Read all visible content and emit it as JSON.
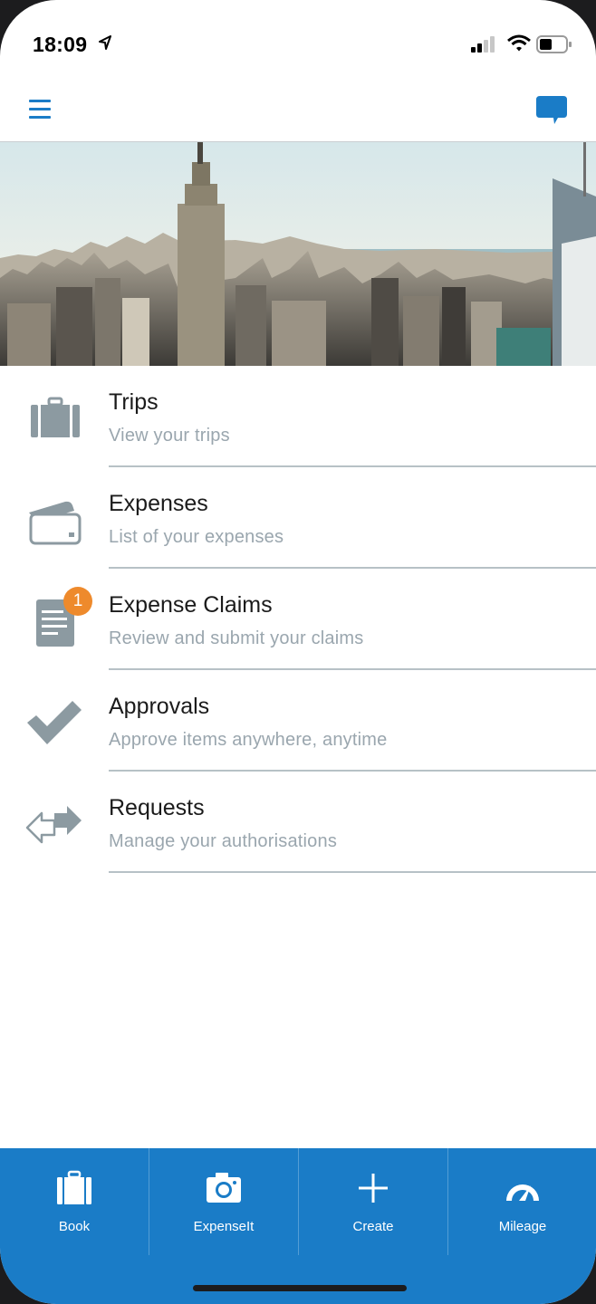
{
  "status_bar": {
    "time": "18:09"
  },
  "nav": {
    "menu_icon": "hamburger-icon",
    "chat_icon": "chat-bubble-icon",
    "accent_color": "#1a7cc7"
  },
  "hero": {
    "description_icon": "city-skyline-image"
  },
  "menu": {
    "items": [
      {
        "title": "Trips",
        "subtitle": "View your trips",
        "icon": "briefcase-icon"
      },
      {
        "title": "Expenses",
        "subtitle": "List of your expenses",
        "icon": "credit-card-icon"
      },
      {
        "title": "Expense Claims",
        "subtitle": "Review and submit your claims",
        "icon": "document-icon",
        "badge": "1"
      },
      {
        "title": "Approvals",
        "subtitle": "Approve items anywhere, anytime",
        "icon": "checkmark-icon"
      },
      {
        "title": "Requests",
        "subtitle": "Manage your authorisations",
        "icon": "arrows-icon"
      }
    ],
    "badge_color": "#ee8a2c"
  },
  "tab_bar": {
    "tabs": [
      {
        "label": "Book",
        "icon": "briefcase-icon"
      },
      {
        "label": "ExpenseIt",
        "icon": "camera-icon"
      },
      {
        "label": "Create",
        "icon": "plus-icon"
      },
      {
        "label": "Mileage",
        "icon": "speedometer-icon"
      }
    ],
    "color": "#1a7cc7"
  }
}
